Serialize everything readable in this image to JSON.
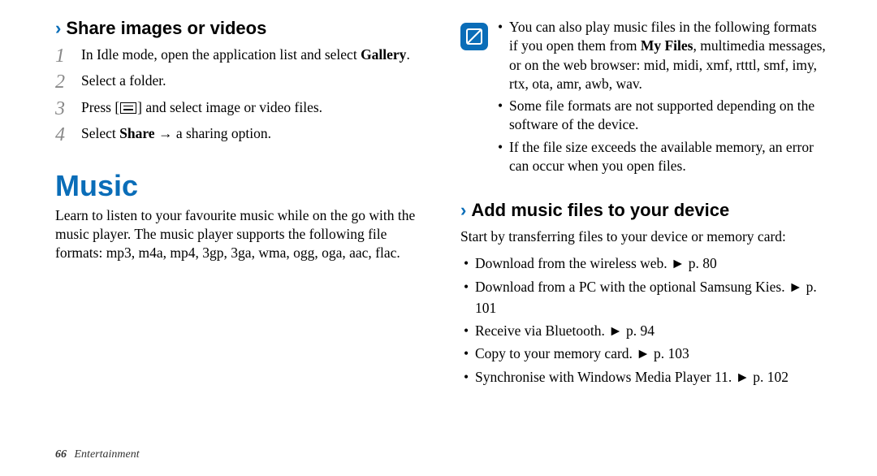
{
  "left": {
    "share_heading": "Share images or videos",
    "steps": {
      "s1_pre": "In Idle mode, open the application list and select ",
      "s1_bold": "Gallery",
      "s1_post": ".",
      "s2": "Select a folder.",
      "s3_pre": "Press [",
      "s3_post": "] and select image or video files.",
      "s4_pre": "Select ",
      "s4_bold": "Share",
      "s4_post": " → a sharing option."
    },
    "music_heading": "Music",
    "music_para": "Learn to listen to your favourite music while on the go with the music player. The music player supports the following file formats: mp3, m4a, mp4, 3gp, 3ga, wma, ogg, oga, aac, flac."
  },
  "right": {
    "note": {
      "li1_pre": "You can also play music files in the following formats if you open them from ",
      "li1_bold": "My Files",
      "li1_post": ", multimedia messages, or on the web browser: mid, midi, xmf, rtttl, smf, imy, rtx, ota, amr, awb, wav.",
      "li2": "Some file formats are not supported depending on the software of the device.",
      "li3": "If the file size exceeds the available memory, an error can occur when you open files."
    },
    "add_heading": "Add music files to your device",
    "transfer_intro": "Start by transferring files to your device or memory card:",
    "transfer": {
      "t1": "Download from the wireless web. ► p. 80",
      "t2": "Download from a PC with the optional Samsung Kies. ► p. 101",
      "t3": "Receive via Bluetooth. ► p. 94",
      "t4": "Copy to your memory card. ► p. 103",
      "t5": "Synchronise with Windows Media Player 11. ► p. 102"
    }
  },
  "footer": {
    "page": "66",
    "section": "Entertainment"
  }
}
